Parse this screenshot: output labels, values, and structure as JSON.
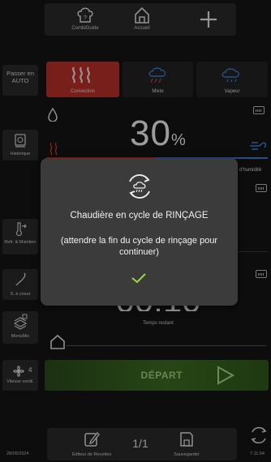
{
  "top_nav": {
    "combiguide_label": "CombiGuide",
    "home_label": "Accueil"
  },
  "left_panel": {
    "auto_label": "Passer en AUTO",
    "history_label": "Historique",
    "hold_label": "Refr. & Maintien",
    "probe_label": "S. à coeur",
    "menumix_label": "MenuMix",
    "fan_speed_value": "4",
    "fan_speed_label": "Vitesse ventil.",
    "date": "28/05/2024"
  },
  "modes": {
    "convection_label": "Convection",
    "mixed_label": "Mixte",
    "steam_label": "Vapeur",
    "active": "convection",
    "active_color": "#b8302c"
  },
  "humidity": {
    "value": "30",
    "unit": "%",
    "label": "e d'humidité"
  },
  "timer": {
    "value": "00:10",
    "label": "Temps restant"
  },
  "start_button": {
    "label": "DÉPART",
    "color": "#3c6b22"
  },
  "bottom_nav": {
    "editor_label": "Editeur de Recettes",
    "page": "1/1",
    "save_label": "Sauvegarder"
  },
  "clock": "7:11:54",
  "modal": {
    "title": "Chaudière en cycle de RINÇAGE",
    "message": "(attendre la fin du cycle de rinçage pour continuer)",
    "icon": "rinse-cycle-icon",
    "confirm_icon": "checkmark-icon",
    "confirm_color": "#9bd64a"
  }
}
